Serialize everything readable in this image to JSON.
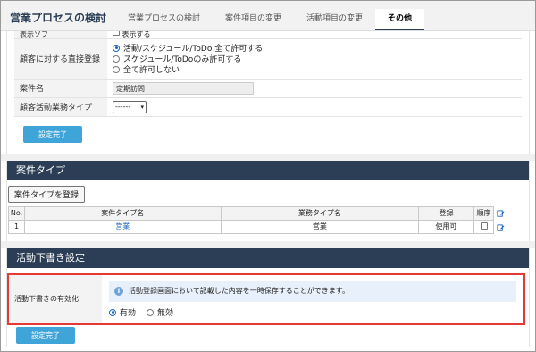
{
  "header": {
    "title": "営業プロセスの検討",
    "tabs": [
      "営業プロセスの検討",
      "案件項目の変更",
      "活動項目の変更",
      "その他"
    ]
  },
  "top_form": {
    "cut_off_label": "表示ソフ",
    "cut_off_value": "表示する",
    "direct_reg_label": "顧客に対する直接登録",
    "direct_reg_options": [
      "活動/スケジュール/ToDo 全て許可する",
      "スケジュール/ToDoのみ許可する",
      "全て許可しない"
    ],
    "case_name_label": "案件名",
    "case_name_value": "定期訪問",
    "activity_type_label": "顧客活動業務タイプ",
    "activity_type_value": "------"
  },
  "buttons": {
    "save1": "設定完了",
    "save2": "設定完了",
    "register_case_type": "案件タイプを登録"
  },
  "case_type_section": {
    "title": "案件タイプ",
    "columns": [
      "No.",
      "案件タイプ名",
      "業務タイプ名",
      "登録",
      "順序"
    ],
    "rows": [
      {
        "no": "1",
        "name": "営業",
        "biz_type": "営業",
        "status": "使用可"
      }
    ]
  },
  "draft_section": {
    "title": "活動下書き設定",
    "label": "活動下書きの有効化",
    "info": "活動登録画面において記載した内容を一時保存することができます。",
    "options": [
      "有効",
      "無効"
    ],
    "selected": "有効"
  },
  "colors": {
    "accent": "#3fa5d8",
    "section_bar": "#2b3e55",
    "highlight": "#e53935",
    "link": "#1a63b8"
  }
}
